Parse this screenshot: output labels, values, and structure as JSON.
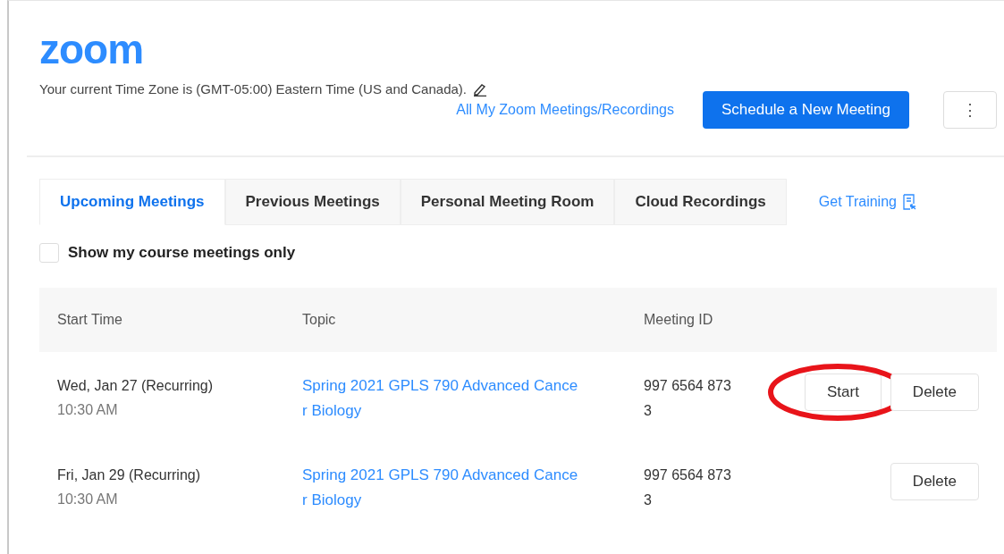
{
  "logo": "zoom",
  "timezone": "Your current Time Zone is (GMT-05:00) Eastern Time (US and Canada).",
  "all_link": "All My Zoom Meetings/Recordings",
  "schedule_button": "Schedule a New Meeting",
  "more_button": "⋮",
  "tabs": [
    {
      "label": "Upcoming Meetings",
      "selected": true
    },
    {
      "label": "Previous Meetings",
      "selected": false
    },
    {
      "label": "Personal Meeting Room",
      "selected": false
    },
    {
      "label": "Cloud Recordings",
      "selected": false
    }
  ],
  "training_link": "Get Training",
  "course_filter": {
    "label": "Show my course meetings only",
    "checked": false
  },
  "table": {
    "columns": [
      "Start Time",
      "Topic",
      "Meeting ID"
    ],
    "rows": [
      {
        "date": "Wed, Jan 27 (Recurring)",
        "time": "10:30 AM",
        "topic_lines": [
          "Spring 2021 GPLS 790 Advanced Cance",
          "r Biology"
        ],
        "id_lines": [
          "997 6564 873",
          "3"
        ],
        "actions": [
          {
            "label": "Start",
            "circled": true
          },
          {
            "label": "Delete",
            "circled": false
          }
        ]
      },
      {
        "date": "Fri, Jan 29 (Recurring)",
        "time": "10:30 AM",
        "topic_lines": [
          "Spring 2021 GPLS 790 Advanced Cance",
          "r Biology"
        ],
        "id_lines": [
          "997 6564 873",
          "3"
        ],
        "actions": [
          {
            "label": "Delete",
            "circled": false
          }
        ]
      }
    ]
  }
}
